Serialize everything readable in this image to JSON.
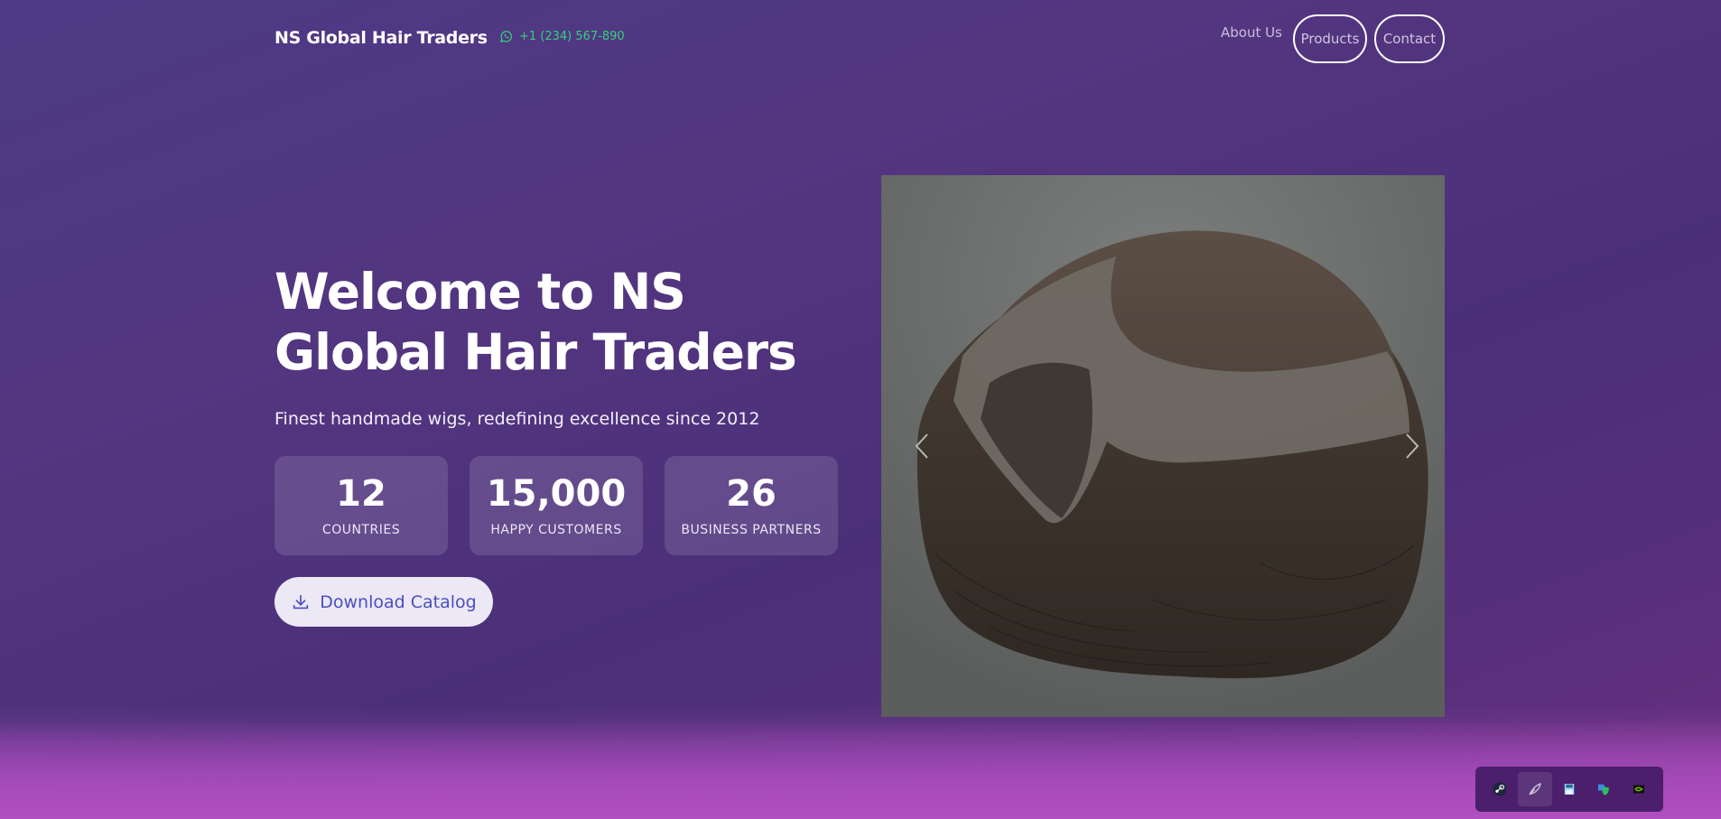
{
  "header": {
    "brand": "NS Global Hair Traders",
    "phone": "+1 (234) 567-890",
    "nav": {
      "about": "About Us",
      "products": "Products",
      "contact": "Contact"
    }
  },
  "hero": {
    "title": "Welcome to NS Global Hair Traders",
    "subtitle": "Finest handmade wigs, redefining excellence since 2012",
    "stats": [
      {
        "value": "12",
        "label": "COUNTRIES"
      },
      {
        "value": "15,000",
        "label": "HAPPY CUSTOMERS"
      },
      {
        "value": "26",
        "label": "BUSINESS PARTNERS"
      }
    ],
    "download_label": "Download Catalog"
  },
  "carousel": {
    "prev_icon": "chevron-left-icon",
    "next_icon": "chevron-right-icon"
  },
  "tray": {
    "icons": [
      "steam-icon",
      "feather-icon",
      "floppy-icon",
      "shield-icon",
      "nvidia-icon"
    ]
  },
  "colors": {
    "accent_phone": "#35d27a",
    "button_text": "#4a4fc0",
    "background": "#4d3a86"
  }
}
